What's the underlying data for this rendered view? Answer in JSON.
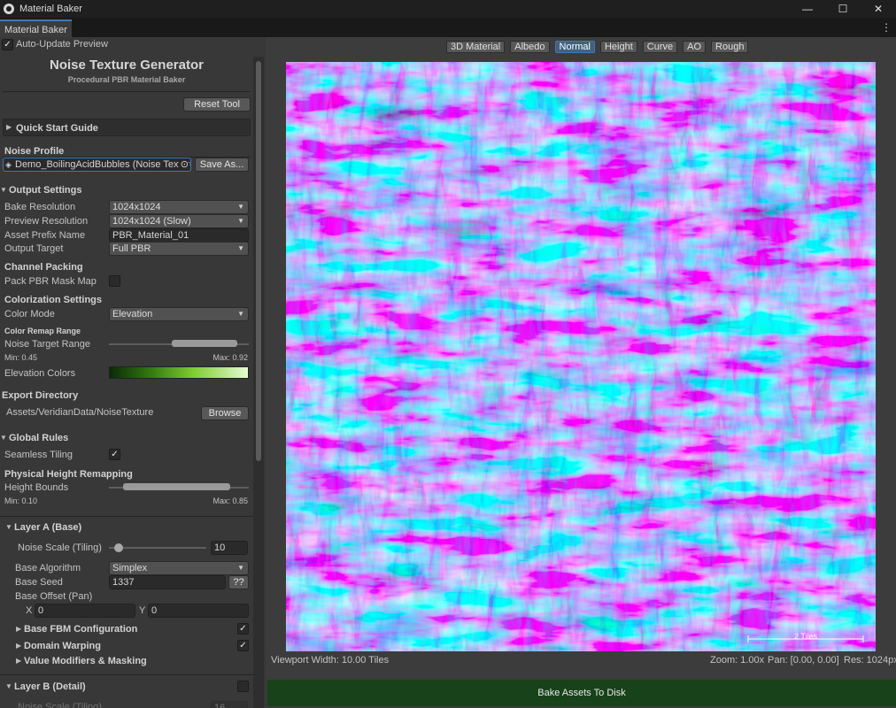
{
  "window": {
    "title": "Material Baker",
    "minimize": "—",
    "maximize": "☐",
    "close": "✕"
  },
  "tab": {
    "label": "Material Baker",
    "menu": "⋮"
  },
  "auto_update": {
    "label": "Auto-Update Preview",
    "checked": true
  },
  "header": {
    "title": "Noise Texture Generator",
    "subtitle": "Procedural PBR Material Baker",
    "reset": "Reset Tool"
  },
  "quick_start": {
    "label": "Quick Start Guide"
  },
  "noise_profile": {
    "label": "Noise Profile",
    "value": "Demo_BoilingAcidBubbles (Noise Texture",
    "save_as": "Save As..."
  },
  "output": {
    "title": "Output Settings",
    "bake_resolution": {
      "label": "Bake Resolution",
      "value": "1024x1024"
    },
    "preview_resolution": {
      "label": "Preview Resolution",
      "value": "1024x1024 (Slow)"
    },
    "asset_prefix": {
      "label": "Asset Prefix Name",
      "value": "PBR_Material_01"
    },
    "output_target": {
      "label": "Output Target",
      "value": "Full PBR"
    }
  },
  "channel_packing": {
    "title": "Channel Packing",
    "pack_label": "Pack PBR Mask Map",
    "checked": false
  },
  "colorization": {
    "title": "Colorization Settings",
    "color_mode": {
      "label": "Color Mode",
      "value": "Elevation"
    },
    "remap_title": "Color Remap Range",
    "noise_target": {
      "label": "Noise Target Range",
      "min_label": "Min: 0.45",
      "max_label": "Max: 0.92",
      "min": 0.45,
      "max": 0.92
    },
    "elevation_colors": "Elevation Colors"
  },
  "export": {
    "title": "Export Directory",
    "path": "Assets/VeridianData/NoiseTexture",
    "browse": "Browse"
  },
  "global_rules": {
    "title": "Global Rules",
    "seamless": {
      "label": "Seamless Tiling",
      "checked": true
    }
  },
  "physical_height": {
    "title": "Physical Height Remapping",
    "label": "Height Bounds",
    "min_label": "Min: 0.10",
    "max_label": "Max: 0.85",
    "min": 0.1,
    "max": 0.85
  },
  "layer_a": {
    "title": "Layer A (Base)",
    "noise_scale": {
      "label": "Noise Scale (Tiling)",
      "value": "10",
      "fraction": 0.05
    },
    "algorithm": {
      "label": "Base Algorithm",
      "value": "Simplex"
    },
    "seed": {
      "label": "Base Seed",
      "value": "1337",
      "random": "??"
    },
    "offset": {
      "label": "Base Offset (Pan)",
      "x_label": "X",
      "x": "0",
      "y_label": "Y",
      "y": "0"
    },
    "fbm": {
      "label": "Base FBM Configuration",
      "checked": true
    },
    "domain_warping": {
      "label": "Domain Warping",
      "checked": true
    },
    "value_modifiers": {
      "label": "Value Modifiers & Masking"
    }
  },
  "layer_b": {
    "title": "Layer B (Detail)",
    "checked": false,
    "noise_scale": {
      "label": "Noise Scale (Tiling)",
      "value": "16"
    }
  },
  "view_tabs": [
    "3D Material",
    "Albedo",
    "Normal",
    "Height",
    "Curve",
    "AO",
    "Rough"
  ],
  "active_view": "Normal",
  "viewport": {
    "scale_label": "2 Tiles",
    "width": "Viewport Width: 10.00 Tiles",
    "zoom": "Zoom: 1.00x",
    "pan": "Pan: [0.00, 0.00]",
    "res": "Res: 1024px"
  },
  "bake_button": "Bake Assets To Disk",
  "colors": {
    "normal_pink": "#e07ae8",
    "normal_cyan": "#5ee6d0",
    "normal_lavender": "#c9b2ee",
    "bake_green": "#17421a",
    "accent_blue": "#3a79bb"
  }
}
